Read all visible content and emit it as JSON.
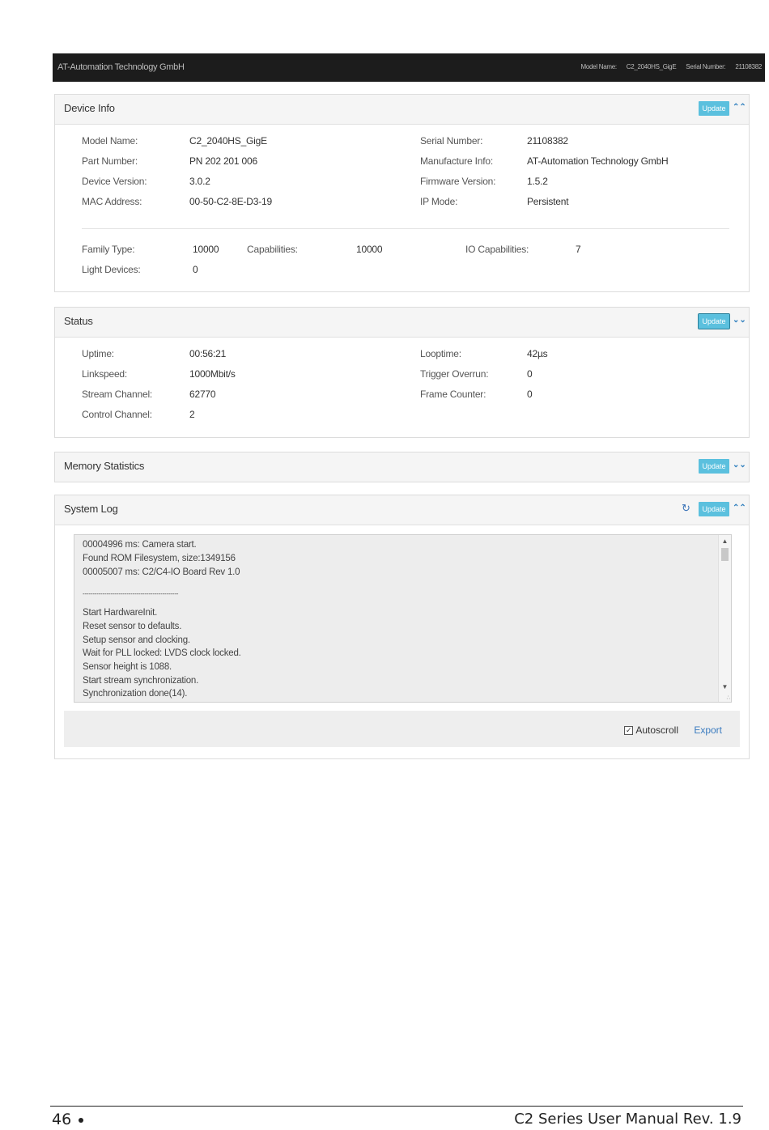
{
  "topbar": {
    "brand": "AT-Automation Technology GmbH",
    "model_label": "Model Name:",
    "model_value": "C2_2040HS_GigE",
    "serial_label": "Serial Number:",
    "serial_value": "21108382"
  },
  "update_label": "Update",
  "device_info": {
    "title": "Device Info",
    "left": [
      {
        "label": "Model Name:",
        "value": "C2_2040HS_GigE"
      },
      {
        "label": "Part Number:",
        "value": "PN 202 201 006"
      },
      {
        "label": "Device Version:",
        "value": "3.0.2"
      },
      {
        "label": "MAC Address:",
        "value": "00-50-C2-8E-D3-19"
      }
    ],
    "right": [
      {
        "label": "Serial Number:",
        "value": "21108382"
      },
      {
        "label": "Manufacture Info:",
        "value": "AT-Automation Technology GmbH"
      },
      {
        "label": "Firmware Version:",
        "value": "1.5.2"
      },
      {
        "label": "IP Mode:",
        "value": "Persistent"
      }
    ],
    "family_label": "Family Type:",
    "family_value": "10000",
    "capabilities_label": "Capabilities:",
    "capabilities_value": "10000",
    "io_label": "IO Capabilities:",
    "io_value": "7",
    "light_label": "Light Devices:",
    "light_value": "0"
  },
  "status": {
    "title": "Status",
    "left": [
      {
        "label": "Uptime:",
        "value": "00:56:21"
      },
      {
        "label": "Linkspeed:",
        "value": "1000Mbit/s"
      },
      {
        "label": "Stream Channel:",
        "value": "62770"
      },
      {
        "label": "Control Channel:",
        "value": "2"
      }
    ],
    "right": [
      {
        "label": "Looptime:",
        "value": "42µs"
      },
      {
        "label": "Trigger Overrun:",
        "value": "0"
      },
      {
        "label": "Frame Counter:",
        "value": "0"
      }
    ]
  },
  "memory": {
    "title": "Memory Statistics"
  },
  "system_log": {
    "title": "System Log",
    "lines": [
      "00004996 ms: Camera start.",
      "Found ROM Filesystem, size:1349156",
      "00005007 ms: C2/C4-IO Board Rev 1.0",
      "",
      "------------------------------------------------",
      "Start HardwareInit.",
      "Reset sensor to defaults.",
      "Setup sensor and clocking.",
      "Wait for PLL locked: LVDS clock locked.",
      "Sensor height is 1088.",
      "Start stream synchronization.",
      "Synchronization done(14)."
    ],
    "autoscroll_label": "Autoscroll",
    "autoscroll_checked": true,
    "export_label": "Export"
  },
  "page_footer": {
    "page_number": "46",
    "doc_title": "C2 Series User Manual Rev. 1.9"
  },
  "colors": {
    "update_button": "#5bc0de",
    "topbar": "#1c1c1c",
    "link": "#3a7bbf"
  },
  "icons": {
    "collapse": "chevron-double-up-icon",
    "expand": "chevron-double-down-icon",
    "refresh": "refresh-icon"
  }
}
